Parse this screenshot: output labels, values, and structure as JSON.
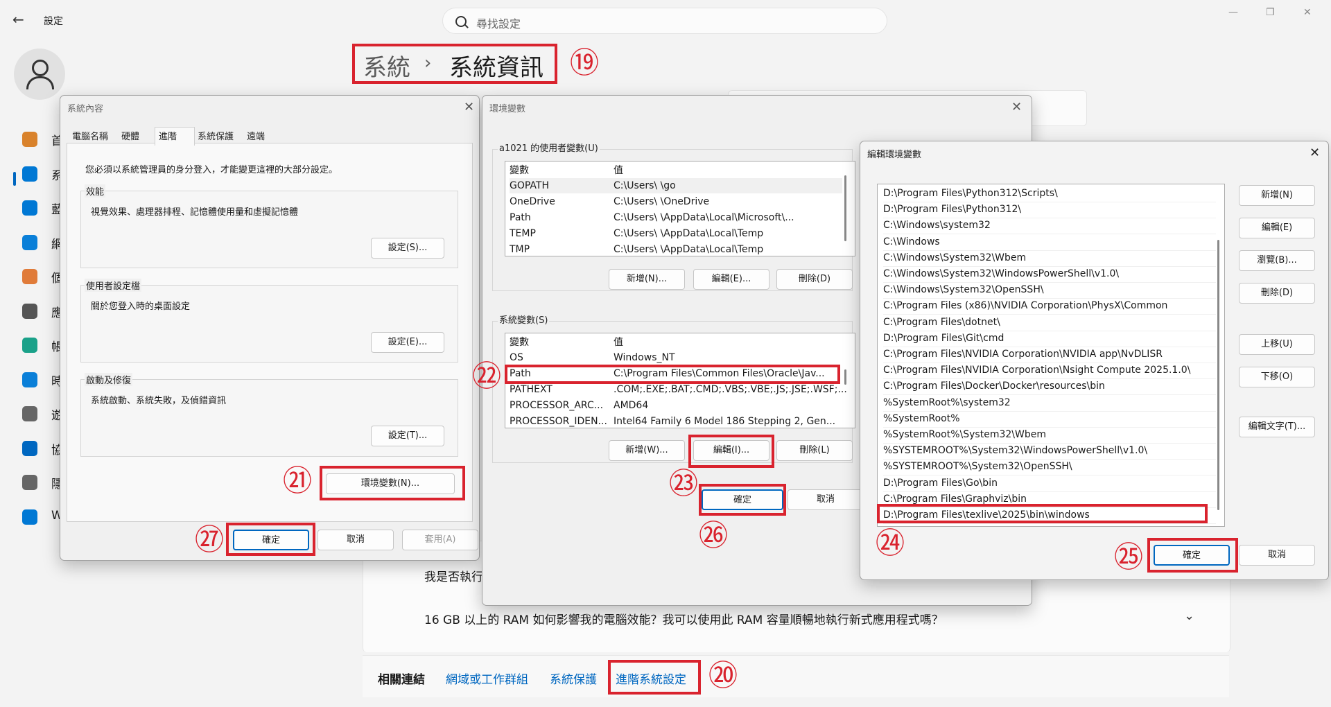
{
  "settings": {
    "app_title": "設定",
    "search_placeholder": "尋找設定",
    "breadcrumb_root": "系統",
    "breadcrumb_sep": "›",
    "breadcrumb_current": "系統資訊",
    "nav": [
      {
        "label": "首",
        "icon": "home-icon",
        "color": "#d9822b"
      },
      {
        "label": "系",
        "icon": "system-icon",
        "color": "#0078d4"
      },
      {
        "label": "藍",
        "icon": "bluetooth-icon",
        "color": "#0078d4"
      },
      {
        "label": "網",
        "icon": "wifi-icon",
        "color": "#0a7fd8"
      },
      {
        "label": "個",
        "icon": "brush-icon",
        "color": "#e07b39"
      },
      {
        "label": "應",
        "icon": "apps-icon",
        "color": "#555555"
      },
      {
        "label": "帳",
        "icon": "account-icon",
        "color": "#1aa189"
      },
      {
        "label": "時",
        "icon": "clock-globe-icon",
        "color": "#0a7fd8"
      },
      {
        "label": "遊",
        "icon": "gamepad-icon",
        "color": "#666666"
      },
      {
        "label": "協",
        "icon": "accessibility-icon",
        "color": "#0067c0"
      },
      {
        "label": "隱",
        "icon": "shield-icon",
        "color": "#666666"
      },
      {
        "label": "W",
        "icon": "update-icon",
        "color": "#0078d4"
      }
    ],
    "faq1": "我是否執行",
    "faq2": "16 GB 以上的 RAM 如何影響我的電腦效能？我可以使用此 RAM 容量順暢地執行新式應用程式嗎？",
    "related_label": "相關連結",
    "related_links": [
      "網域或工作群組",
      "系統保護",
      "進階系統設定"
    ]
  },
  "markers": {
    "m19": "⑲",
    "m20": "⑳",
    "m21": "㉑",
    "m22": "㉒",
    "m23": "㉓",
    "m24": "㉔",
    "m25": "㉕",
    "m26": "㉖",
    "m27": "㉗"
  },
  "sysprops": {
    "title": "系統內容",
    "tabs": [
      "電腦名稱",
      "硬體",
      "進階",
      "系統保護",
      "遠端"
    ],
    "admin_note": "您必須以系統管理員的身分登入，才能變更這裡的大部分設定。",
    "performance": {
      "label": "效能",
      "desc": "視覺效果、處理器排程、記憶體使用量和虛擬記憶體",
      "button": "設定(S)..."
    },
    "profiles": {
      "label": "使用者設定檔",
      "desc": "關於您登入時的桌面設定",
      "button": "設定(E)..."
    },
    "startup": {
      "label": "啟動及修復",
      "desc": "系統啟動、系統失敗，及偵錯資訊",
      "button": "設定(T)..."
    },
    "env_button": "環境變數(N)...",
    "ok": "確定",
    "cancel": "取消",
    "apply": "套用(A)"
  },
  "envvars": {
    "title": "環境變數",
    "user_group": "a1021 的使用者變數(U)",
    "col_var": "變數",
    "col_val": "值",
    "user_vars": [
      {
        "name": "GOPATH",
        "value": "C:\\Users\\        \\go"
      },
      {
        "name": "OneDrive",
        "value": "C:\\Users\\        \\OneDrive"
      },
      {
        "name": "Path",
        "value": "C:\\Users\\        \\AppData\\Local\\Microsoft\\..."
      },
      {
        "name": "TEMP",
        "value": "C:\\Users\\        \\AppData\\Local\\Temp"
      },
      {
        "name": "TMP",
        "value": "C:\\Users\\        \\AppData\\Local\\Temp"
      }
    ],
    "user_buttons": [
      "新增(N)...",
      "編輯(E)...",
      "刪除(D)"
    ],
    "sys_group": "系統變數(S)",
    "sys_vars": [
      {
        "name": "OS",
        "value": "Windows_NT"
      },
      {
        "name": "Path",
        "value": "C:\\Program Files\\Common Files\\Oracle\\Jav..."
      },
      {
        "name": "PATHEXT",
        "value": ".COM;.EXE;.BAT;.CMD;.VBS;.VBE;.JS;.JSE;.WSF;..."
      },
      {
        "name": "PROCESSOR_ARC...",
        "value": "AMD64"
      },
      {
        "name": "PROCESSOR_IDEN...",
        "value": "Intel64 Family 6 Model 186 Stepping 2, Gen..."
      }
    ],
    "sys_buttons": [
      "新增(W)...",
      "編輯(I)...",
      "刪除(L)"
    ],
    "ok": "確定",
    "cancel": "取消"
  },
  "editenv": {
    "title": "編輯環境變數",
    "paths": [
      "D:\\Program Files\\Python312\\Scripts\\",
      "D:\\Program Files\\Python312\\",
      "C:\\Windows\\system32",
      "C:\\Windows",
      "C:\\Windows\\System32\\Wbem",
      "C:\\Windows\\System32\\WindowsPowerShell\\v1.0\\",
      "C:\\Windows\\System32\\OpenSSH\\",
      "C:\\Program Files (x86)\\NVIDIA Corporation\\PhysX\\Common",
      "C:\\Program Files\\dotnet\\",
      "D:\\Program Files\\Git\\cmd",
      "C:\\Program Files\\NVIDIA Corporation\\NVIDIA app\\NvDLISR",
      "C:\\Program Files\\NVIDIA Corporation\\Nsight Compute 2025.1.0\\",
      "C:\\Program Files\\Docker\\Docker\\resources\\bin",
      "%SystemRoot%\\system32",
      "%SystemRoot%",
      "%SystemRoot%\\System32\\Wbem",
      "%SYSTEMROOT%\\System32\\WindowsPowerShell\\v1.0\\",
      "%SYSTEMROOT%\\System32\\OpenSSH\\",
      "D:\\Program Files\\Go\\bin",
      "C:\\Program Files\\Graphviz\\bin",
      "D:\\Program Files\\texlive\\2025\\bin\\windows"
    ],
    "buttons": [
      "新增(N)",
      "編輯(E)",
      "瀏覽(B)...",
      "刪除(D)",
      "上移(U)",
      "下移(O)",
      "編輯文字(T)..."
    ],
    "ok": "確定",
    "cancel": "取消"
  }
}
